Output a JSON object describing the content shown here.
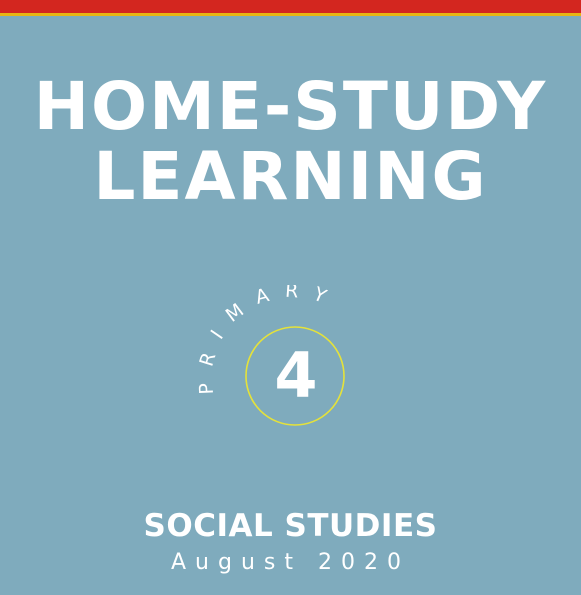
{
  "colors": {
    "background": "#7fabbd",
    "stripe_red": "#d3261f",
    "stripe_yellow": "#e8b614",
    "circle_outline": "#e5e23a",
    "text": "#ffffff"
  },
  "cover": {
    "title_line1": "HOME-STUDY",
    "title_line2": "LEARNING",
    "level_label": "PRIMARY",
    "grade": "4",
    "subject": "SOCIAL STUDIES",
    "date": "August 2020"
  }
}
